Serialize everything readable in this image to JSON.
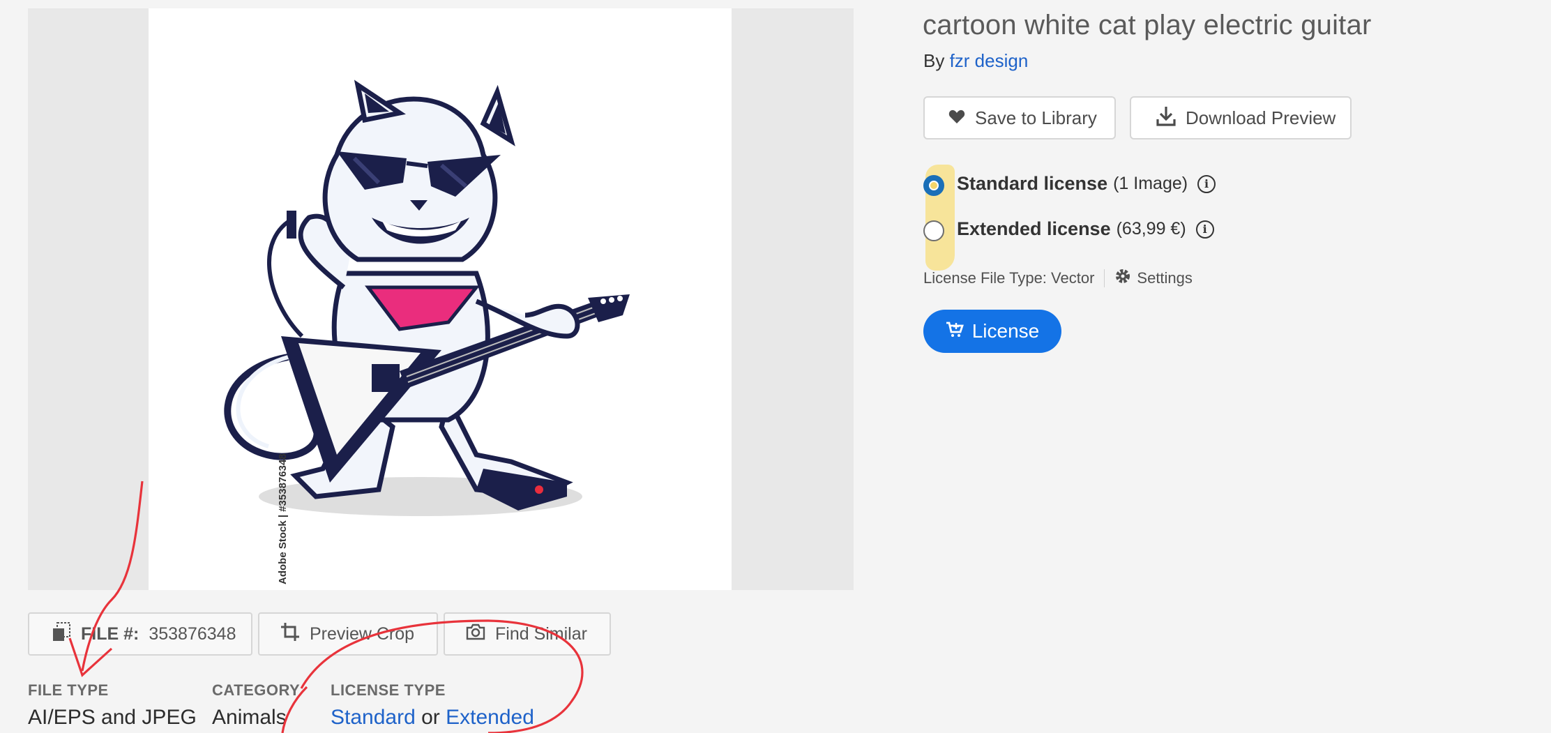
{
  "asset": {
    "title": "cartoon white cat play electric guitar",
    "by_prefix": "By",
    "author": "fzr design",
    "watermark_credit": "Adobe Stock | #353876348"
  },
  "actions": {
    "save_to_library": "Save to Library",
    "download_preview": "Download Preview"
  },
  "licenses": {
    "standard": {
      "name": "Standard license",
      "detail": "(1 Image)",
      "selected": true
    },
    "extended": {
      "name": "Extended license",
      "detail": "(63,99 €)",
      "selected": false
    },
    "file_type_text": "License File Type: Vector",
    "settings_label": "Settings",
    "license_button": "License"
  },
  "bottom_actions": {
    "file_label": "FILE #:",
    "file_number": "353876348",
    "preview_crop": "Preview Crop",
    "find_similar": "Find Similar"
  },
  "meta": {
    "file_type_label": "FILE TYPE",
    "file_type_value": "AI/EPS and JPEG",
    "category_label": "CATEGORY",
    "category_value": "Animals",
    "license_type_label": "LICENSE TYPE",
    "license_standard": "Standard",
    "license_or": "or",
    "license_extended": "Extended"
  },
  "colors": {
    "accent_blue": "#1473e6",
    "link_blue": "#1e62c9",
    "annotation_red": "#e8333b",
    "highlight_yellow": "#f7e08a"
  },
  "icons": [
    "heart-icon",
    "download-icon",
    "info-icon",
    "gear-icon",
    "cart-icon",
    "file-icon",
    "crop-icon",
    "camera-icon"
  ]
}
